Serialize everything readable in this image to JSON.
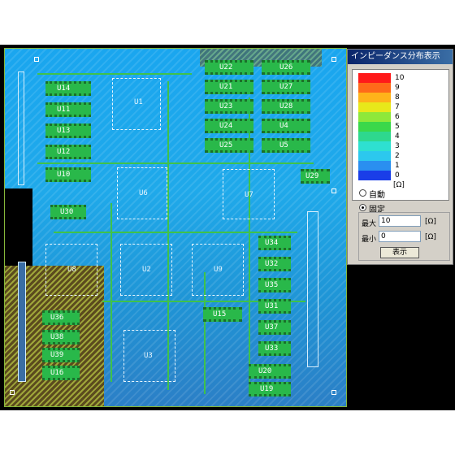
{
  "panel": {
    "title": "インピーダンス分布表示",
    "legend": [
      {
        "label": "10",
        "color": "#ff1a1a"
      },
      {
        "label": "9",
        "color": "#ff6a1a"
      },
      {
        "label": "8",
        "color": "#ffb31a"
      },
      {
        "label": "7",
        "color": "#e8e81a"
      },
      {
        "label": "6",
        "color": "#8ee83a"
      },
      {
        "label": "5",
        "color": "#3ad84a"
      },
      {
        "label": "4",
        "color": "#2ed88e"
      },
      {
        "label": "3",
        "color": "#2ee0d0"
      },
      {
        "label": "2",
        "color": "#2cc8ee"
      },
      {
        "label": "1",
        "color": "#2a8ff0"
      },
      {
        "label": "0",
        "color": "#1a3ee8"
      }
    ],
    "unit": "[Ω]",
    "mode_auto": "自動",
    "mode_fixed": "固定",
    "max_label": "最大",
    "max_value": "10",
    "min_label": "最小",
    "min_value": "0",
    "unit_suffix": "[Ω]",
    "show_button": "表示"
  },
  "board": {
    "chips": [
      {
        "label": "U1"
      },
      {
        "label": "U6"
      },
      {
        "label": "U7"
      },
      {
        "label": "U8"
      },
      {
        "label": "U2"
      },
      {
        "label": "U9"
      },
      {
        "label": "U3"
      }
    ],
    "dips": [
      {
        "label": "U14"
      },
      {
        "label": "U11"
      },
      {
        "label": "U13"
      },
      {
        "label": "U12"
      },
      {
        "label": "U10"
      },
      {
        "label": "U30"
      },
      {
        "label": "U22"
      },
      {
        "label": "U26"
      },
      {
        "label": "U21"
      },
      {
        "label": "U27"
      },
      {
        "label": "U23"
      },
      {
        "label": "U28"
      },
      {
        "label": "U24"
      },
      {
        "label": "U4"
      },
      {
        "label": "U25"
      },
      {
        "label": "U5"
      },
      {
        "label": "U29"
      },
      {
        "label": "U34"
      },
      {
        "label": "U32"
      },
      {
        "label": "U35"
      },
      {
        "label": "U15"
      },
      {
        "label": "U31"
      },
      {
        "label": "U37"
      },
      {
        "label": "U33"
      },
      {
        "label": "U20"
      },
      {
        "label": "U19"
      },
      {
        "label": "U36"
      },
      {
        "label": "U38"
      },
      {
        "label": "U39"
      },
      {
        "label": "U16"
      }
    ]
  }
}
